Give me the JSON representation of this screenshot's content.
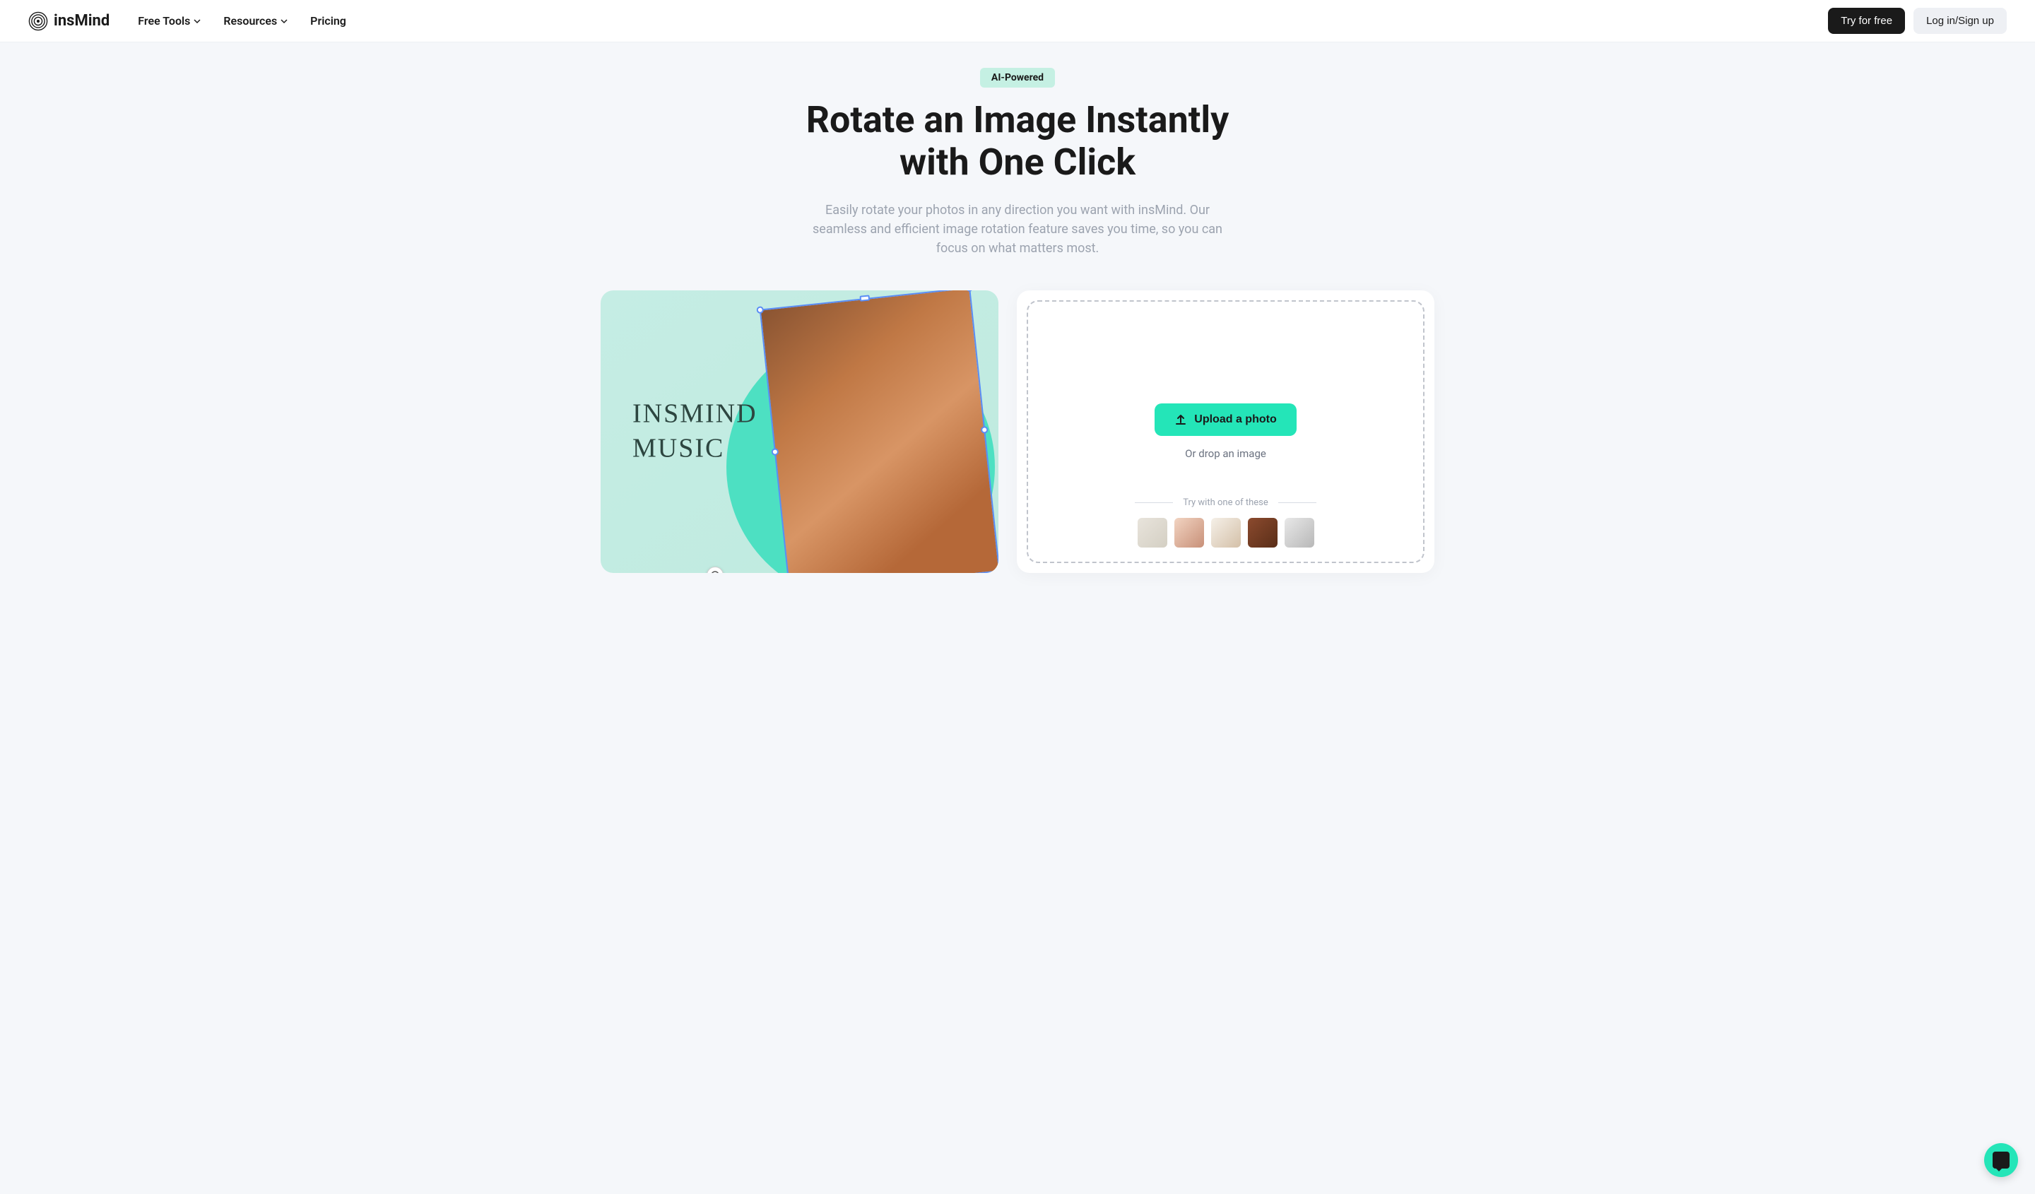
{
  "header": {
    "logo_text": "insMind",
    "nav": {
      "free_tools": "Free Tools",
      "resources": "Resources",
      "pricing": "Pricing"
    },
    "try_free_label": "Try for free",
    "login_label": "Log in/Sign up"
  },
  "hero": {
    "badge": "AI-Powered",
    "title": "Rotate an Image Instantly with One Click",
    "subtitle": "Easily rotate your photos in any direction you want with insMind. Our seamless and efficient image rotation feature saves you time, so you can focus on what matters most."
  },
  "preview": {
    "line1": "INSMIND",
    "line2": "MUSIC"
  },
  "upload": {
    "button_label": "Upload a photo",
    "drop_text": "Or drop an image",
    "samples_label": "Try with one of these"
  }
}
